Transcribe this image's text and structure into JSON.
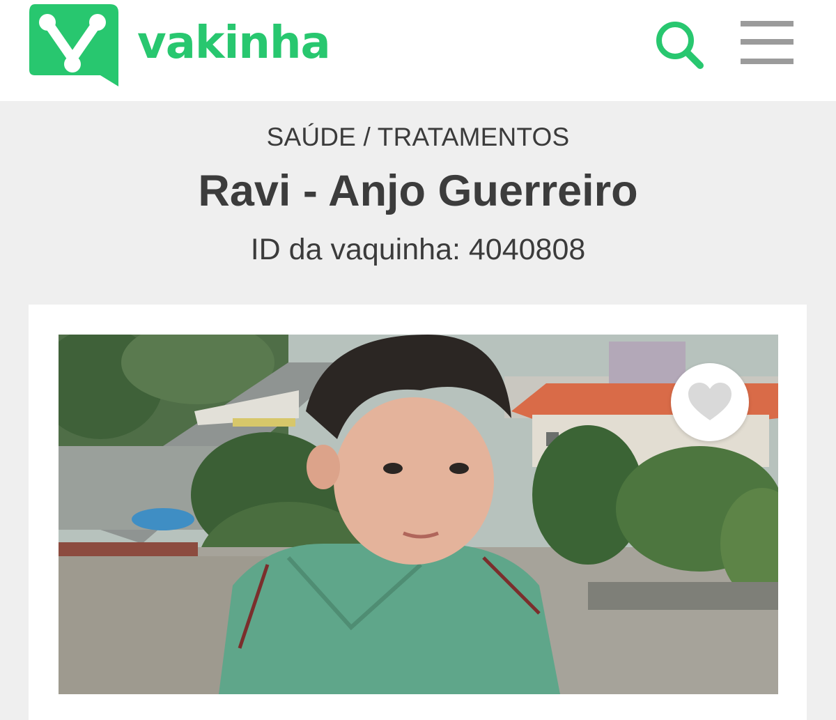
{
  "header": {
    "logo_text": "vakinha",
    "logo_icon": "vakinha-v-logo-icon",
    "search_icon": "search-icon",
    "menu_icon": "hamburger-menu-icon"
  },
  "campaign": {
    "category": "SAÚDE / TRATAMENTOS",
    "title": "Ravi - Anjo Guerreiro",
    "id_text": "ID da vaquinha: 4040808",
    "favorite_icon": "heart-icon"
  },
  "colors": {
    "brand_green": "#28c76f",
    "text_dark": "#3c3c3c",
    "background": "#efefef",
    "icon_gray": "#9b9b9b"
  }
}
